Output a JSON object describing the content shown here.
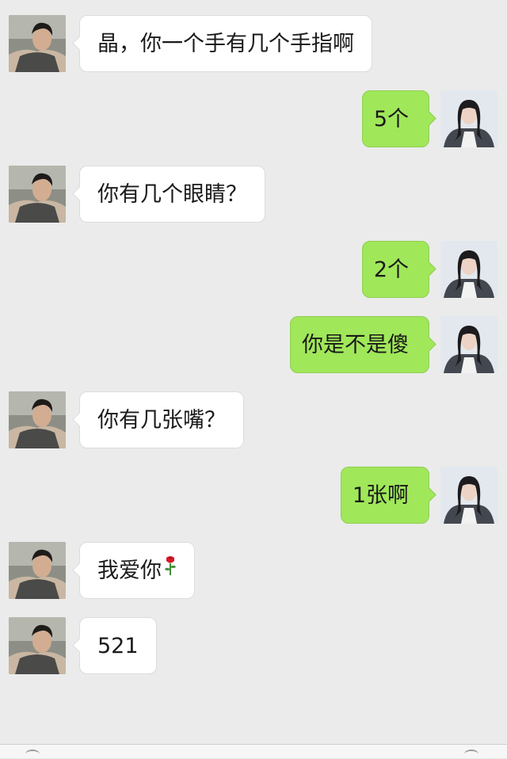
{
  "chat": {
    "messages": [
      {
        "side": "left",
        "sender": "boy",
        "text": "晶，你一个手有几个手指啊"
      },
      {
        "side": "right",
        "sender": "girl",
        "text": "5个"
      },
      {
        "side": "left",
        "sender": "boy",
        "text": "你有几个眼睛？"
      },
      {
        "side": "right",
        "sender": "girl",
        "text": "2个"
      },
      {
        "side": "right",
        "sender": "girl",
        "text": "你是不是傻"
      },
      {
        "side": "left",
        "sender": "boy",
        "text": "你有几张嘴？"
      },
      {
        "side": "right",
        "sender": "girl",
        "text": "1张啊"
      },
      {
        "side": "left",
        "sender": "boy",
        "text": "我爱你",
        "emoji": "rose-icon"
      },
      {
        "side": "left",
        "sender": "boy",
        "text": "521"
      }
    ]
  },
  "colors": {
    "background": "#ebebeb",
    "incoming_bubble": "#ffffff",
    "outgoing_bubble": "#a0e75a"
  }
}
